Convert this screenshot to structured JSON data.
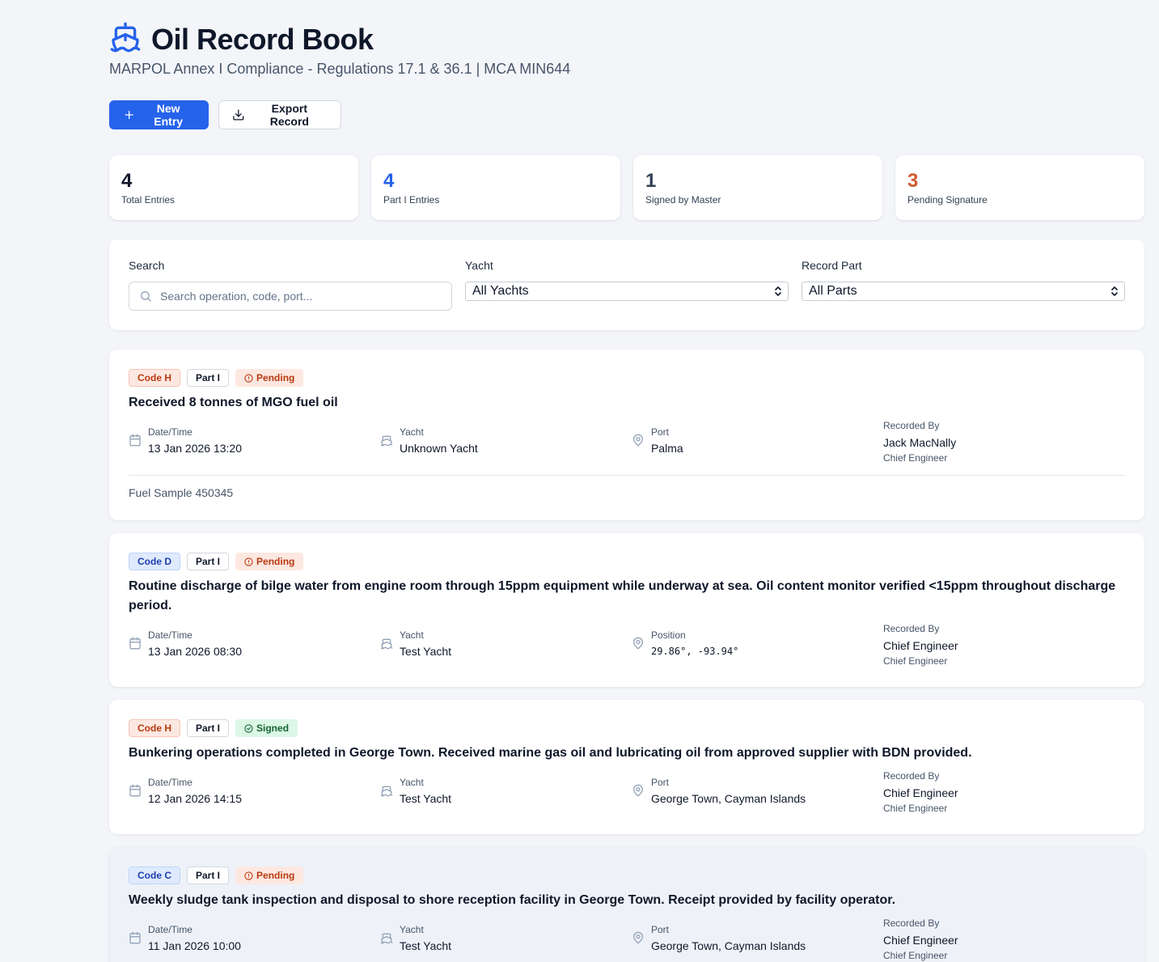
{
  "header": {
    "title": "Oil Record Book",
    "subtitle": "MARPOL Annex I Compliance - Regulations 17.1 & 36.1 | MCA MIN644",
    "icon": "ship-icon",
    "accent": "#2563eb"
  },
  "toolbar": {
    "new_entry_label": "New Entry",
    "export_label": "Export Record"
  },
  "stats": [
    {
      "value": "4",
      "label": "Total Entries",
      "color": "#0f172a"
    },
    {
      "value": "4",
      "label": "Part I Entries",
      "color": "#2563eb"
    },
    {
      "value": "1",
      "label": "Signed by Master",
      "color": "#334155"
    },
    {
      "value": "3",
      "label": "Pending Signature",
      "color": "#d05a2f"
    }
  ],
  "filters": {
    "search_label": "Search",
    "search_placeholder": "Search operation, code, port...",
    "yacht_label": "Yacht",
    "yacht_value": "All Yachts",
    "part_label": "Record Part",
    "part_value": "All Parts"
  },
  "entries": [
    {
      "code": "Code H",
      "part": "Part I",
      "status": "Pending",
      "title": "Received 8 tonnes of MGO fuel oil",
      "datetime_label": "Date/Time",
      "datetime": "13 Jan 2026 13:20",
      "yacht_label": "Yacht",
      "yacht": "Unknown Yacht",
      "location_label": "Port",
      "location": "Palma",
      "recorded_label": "Recorded By",
      "recorded_by": "Jack MacNally",
      "role": "Chief Engineer",
      "notes": "Fuel Sample 450345"
    },
    {
      "code": "Code D",
      "part": "Part I",
      "status": "Pending",
      "title": "Routine discharge of bilge water from engine room through 15ppm equipment while underway at sea. Oil content monitor verified <15ppm throughout discharge period.",
      "datetime_label": "Date/Time",
      "datetime": "13 Jan 2026 08:30",
      "yacht_label": "Yacht",
      "yacht": "Test Yacht",
      "location_label": "Position",
      "location": "29.86°, -93.94°",
      "recorded_label": "Recorded By",
      "recorded_by": "Chief Engineer",
      "role": "Chief Engineer"
    },
    {
      "code": "Code H",
      "part": "Part I",
      "status": "Signed",
      "title": "Bunkering operations completed in George Town. Received marine gas oil and lubricating oil from approved supplier with BDN provided.",
      "datetime_label": "Date/Time",
      "datetime": "12 Jan 2026 14:15",
      "yacht_label": "Yacht",
      "yacht": "Test Yacht",
      "location_label": "Port",
      "location": "George Town, Cayman Islands",
      "recorded_label": "Recorded By",
      "recorded_by": "Chief Engineer",
      "role": "Chief Engineer"
    },
    {
      "code": "Code C",
      "part": "Part I",
      "status": "Pending",
      "title": "Weekly sludge tank inspection and disposal to shore reception facility in George Town. Receipt provided by facility operator.",
      "datetime_label": "Date/Time",
      "datetime": "11 Jan 2026 10:00",
      "yacht_label": "Yacht",
      "yacht": "Test Yacht",
      "location_label": "Port",
      "location": "George Town, Cayman Islands",
      "recorded_label": "Recorded By",
      "recorded_by": "Chief Engineer",
      "role": "Chief Engineer"
    }
  ]
}
